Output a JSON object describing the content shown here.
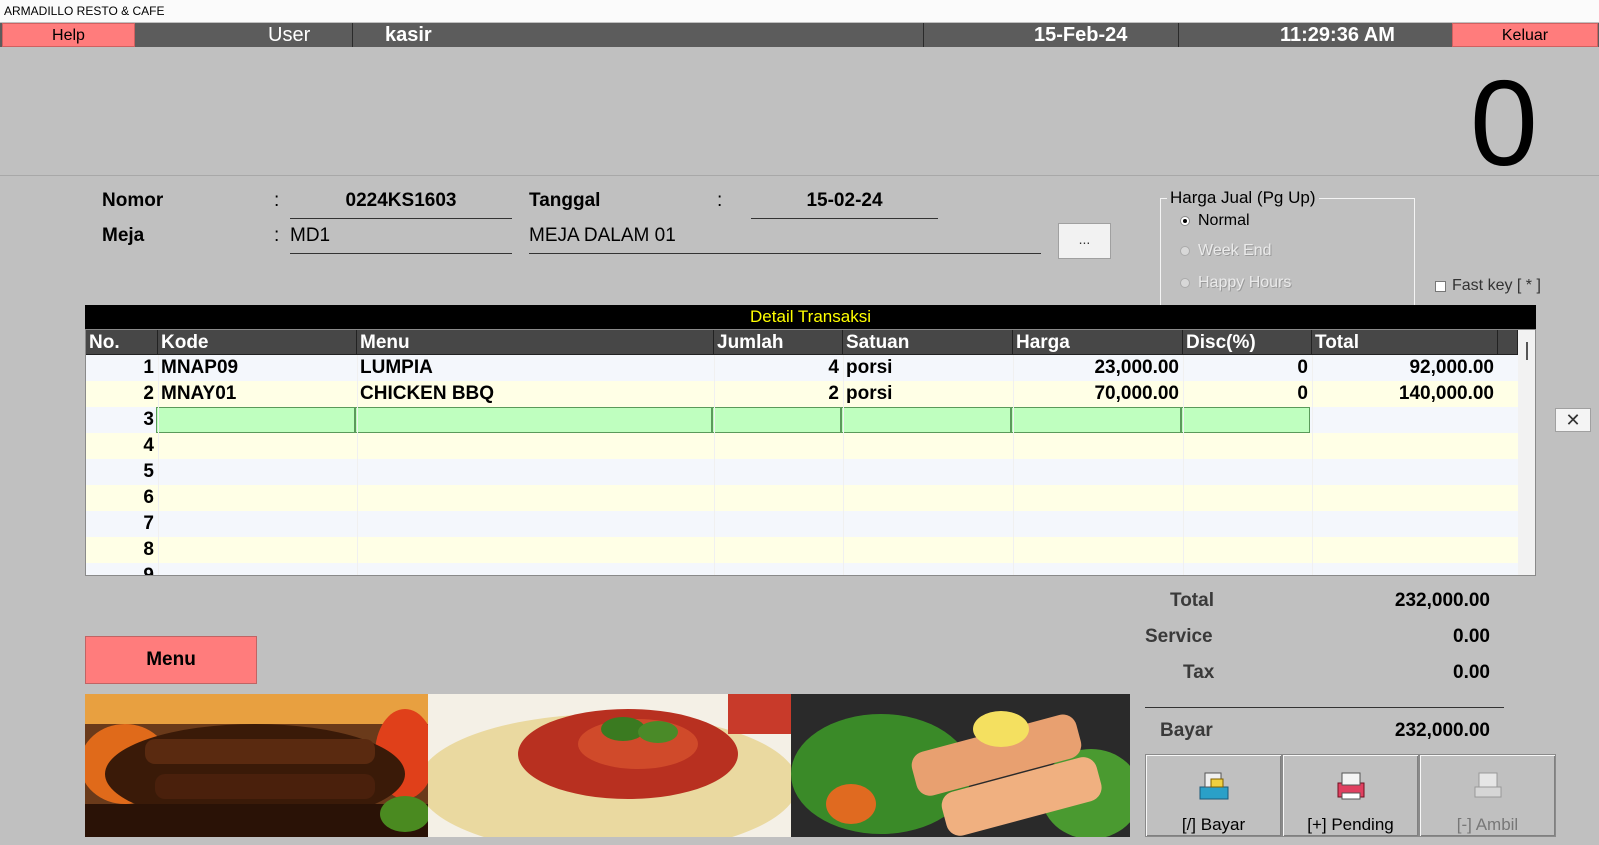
{
  "app_title": "ARMADILLO RESTO & CAFE",
  "topbar": {
    "help_label": "Help",
    "user_label": "User",
    "user_value": "kasir",
    "date": "15-Feb-24",
    "time": "11:29:36 AM",
    "exit_label": "Keluar"
  },
  "big_display": "0",
  "header": {
    "nomor_label": "Nomor",
    "nomor_colon": ":",
    "nomor_value": "0224KS1603",
    "tanggal_label": "Tanggal",
    "tanggal_colon": ":",
    "tanggal_value": "15-02-24",
    "meja_label": "Meja",
    "meja_colon": ":",
    "meja_code": "MD1",
    "meja_name": "MEJA DALAM 01",
    "browse_label": "..."
  },
  "harga_jual": {
    "legend": "Harga Jual (Pg Up)",
    "options": [
      {
        "label": "Normal",
        "selected": true,
        "enabled": true
      },
      {
        "label": "Week End",
        "selected": false,
        "enabled": false
      },
      {
        "label": "Happy Hours",
        "selected": false,
        "enabled": false
      }
    ]
  },
  "fast_key_label": "Fast key [ * ]",
  "grid": {
    "title": "Detail Transaksi",
    "columns": [
      "No.",
      "Kode",
      "Menu",
      "Jumlah",
      "Satuan",
      "Harga",
      "Disc(%)",
      "Total"
    ],
    "rows": [
      {
        "no": "1",
        "kode": "MNAP09",
        "menu": "LUMPIA",
        "jumlah": "4",
        "satuan": "porsi",
        "harga": "23,000.00",
        "disc": "0",
        "total": "92,000.00"
      },
      {
        "no": "2",
        "kode": "MNAY01",
        "menu": "CHICKEN BBQ",
        "jumlah": "2",
        "satuan": "porsi",
        "harga": "70,000.00",
        "disc": "0",
        "total": "140,000.00"
      },
      {
        "no": "3",
        "kode": "",
        "menu": "",
        "jumlah": "",
        "satuan": "",
        "harga": "",
        "disc": "",
        "total": ""
      },
      {
        "no": "4",
        "kode": "",
        "menu": "",
        "jumlah": "",
        "satuan": "",
        "harga": "",
        "disc": "",
        "total": ""
      },
      {
        "no": "5",
        "kode": "",
        "menu": "",
        "jumlah": "",
        "satuan": "",
        "harga": "",
        "disc": "",
        "total": ""
      },
      {
        "no": "6",
        "kode": "",
        "menu": "",
        "jumlah": "",
        "satuan": "",
        "harga": "",
        "disc": "",
        "total": ""
      },
      {
        "no": "7",
        "kode": "",
        "menu": "",
        "jumlah": "",
        "satuan": "",
        "harga": "",
        "disc": "",
        "total": ""
      },
      {
        "no": "8",
        "kode": "",
        "menu": "",
        "jumlah": "",
        "satuan": "",
        "harga": "",
        "disc": "",
        "total": ""
      },
      {
        "no": "9",
        "kode": "",
        "menu": "",
        "jumlah": "",
        "satuan": "",
        "harga": "",
        "disc": "",
        "total": ""
      }
    ],
    "close_icon": "close-icon"
  },
  "menu_button_label": "Menu",
  "summary": {
    "total_label": "Total",
    "total_value": "232,000.00",
    "service_label": "Service",
    "service_value": "0.00",
    "tax_label": "Tax",
    "tax_value": "0.00",
    "bayar_label": "Bayar",
    "bayar_value": "232,000.00"
  },
  "actions": {
    "bayar_label": "[/] Bayar",
    "pending_label": "[+] Pending",
    "ambil_label": "[-] Ambil"
  },
  "colors": {
    "accent_red": "#ff7c7c",
    "topbar_gray": "#5c5c5c",
    "background": "#c0c0c0",
    "grid_title_text": "#ffff00",
    "edit_row": "#bfffbf",
    "row_alt": "#ffffe6"
  }
}
